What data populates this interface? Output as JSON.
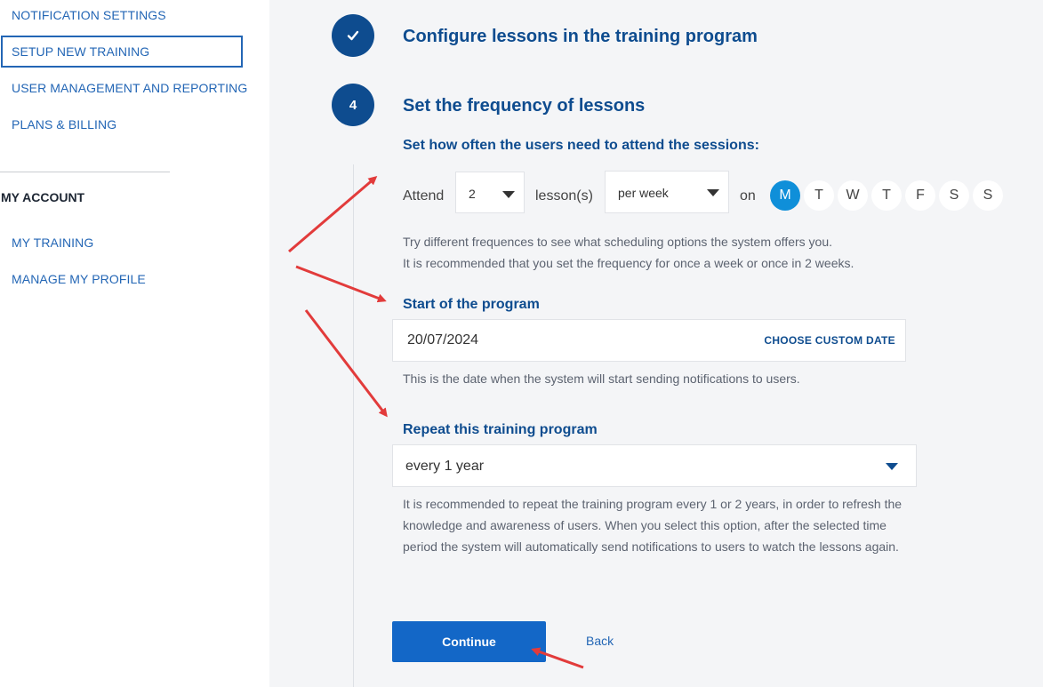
{
  "sidebar": {
    "items": [
      {
        "label": "NOTIFICATION SETTINGS"
      },
      {
        "label": "SETUP NEW TRAINING"
      },
      {
        "label": "USER MANAGEMENT AND REPORTING"
      },
      {
        "label": "PLANS & BILLING"
      }
    ],
    "account_heading": "MY ACCOUNT",
    "account_items": [
      {
        "label": "MY TRAINING"
      },
      {
        "label": "MANAGE MY PROFILE"
      }
    ]
  },
  "steps": {
    "done_icon": "checkmark-icon",
    "done_title": "Configure lessons in the training program",
    "current_number": "4",
    "current_title": "Set the frequency of lessons"
  },
  "frequency": {
    "heading": "Set how often the users need to attend the sessions:",
    "attend_label": "Attend",
    "count_value": "2",
    "lessons_label": "lesson(s)",
    "period_value": "per week",
    "on_label": "on",
    "days": [
      "M",
      "T",
      "W",
      "T",
      "F",
      "S",
      "S"
    ],
    "selected_day_index": 0,
    "hint_line1": "Try different frequences to see what scheduling options the system offers you.",
    "hint_line2": "It is recommended that you set the frequency for once a week or once in 2 weeks."
  },
  "start": {
    "heading": "Start of the program",
    "date_value": "20/07/2024",
    "custom_date_label": "CHOOSE CUSTOM DATE",
    "hint": "This is the date when the system will start sending notifications to users."
  },
  "repeat": {
    "heading": "Repeat this training program",
    "value": "every 1 year",
    "hint_line1": "It is recommended to repeat the training program every 1 or 2 years, in order to refresh the",
    "hint_line2": "knowledge and awareness of users. When you select this option, after the selected time",
    "hint_line3": "period the system will automatically send notifications to users to watch the lessons again."
  },
  "actions": {
    "continue_label": "Continue",
    "back_label": "Back"
  },
  "colors": {
    "primary": "#0e4c8f",
    "link": "#2366b5",
    "button": "#1367c7",
    "selected_day": "#0f8fd9",
    "annotation_arrow": "#e23b3b"
  }
}
